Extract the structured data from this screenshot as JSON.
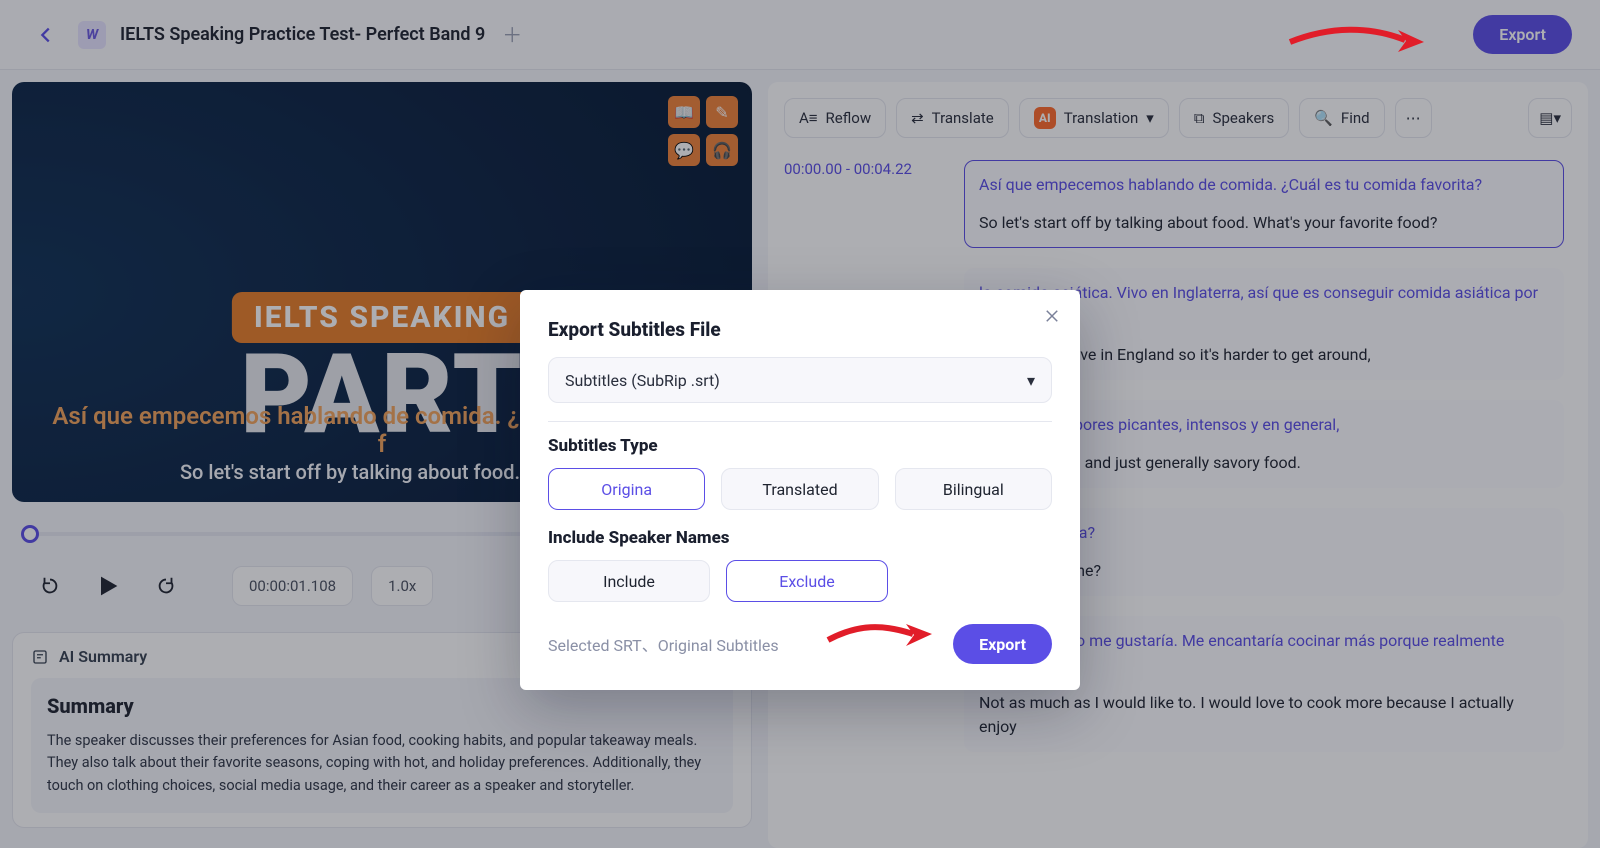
{
  "header": {
    "title": "IELTS Speaking Practice Test- Perfect Band 9",
    "export_label": "Export"
  },
  "video": {
    "ielts_pill": "IELTS SPEAKING",
    "part": "PART",
    "caption_translated": "Así que empecemos hablando de comida. ¿Cuál es tu comida f",
    "caption_original": "So let's start off by talking about food. What's"
  },
  "player": {
    "timecode": "00:00:01.108",
    "speed": "1.0x"
  },
  "summary": {
    "chip": "AI Summary",
    "heading": "Summary",
    "body": "The speaker discusses their preferences for Asian food, cooking habits, and popular takeaway meals. They also talk about their favorite seasons, coping with hot, and holiday preferences. Additionally, they touch on clothing choices, social media usage, and their career as a speaker and storyteller."
  },
  "right_toolbar": {
    "reflow": "Reflow",
    "translate": "Translate",
    "translation": "Translation",
    "speakers": "Speakers",
    "find": "Find"
  },
  "transcript": [
    {
      "ts": "00:00.00 - 00:04.22",
      "es": "Así que empecemos hablando de comida. ¿Cuál es tu comida favorita?",
      "en": "So let's start off by talking about food. What's your favorite food?",
      "selected": true
    },
    {
      "ts": "",
      "es": "la comida asiática. Vivo en Inglaterra, así que es conseguir comida asiática por aquí,",
      "en": "Asian food. I live in England so it's harder to get around,"
    },
    {
      "ts": "",
      "es": "gustan los sabores picantes, intensos y en general,",
      "en": "spicy, flavorful and just generally savory food."
    },
    {
      "ts": "",
      "es": "mucho en casa?",
      "en": "ok a lot at home?"
    },
    {
      "ts": "",
      "es": "No tanto como me gustaría. Me encantaría cocinar más porque realmente disfruto",
      "en": "Not as much as I would like to. I would love to cook more because I actually enjoy"
    }
  ],
  "modal": {
    "title": "Export Subtitles File",
    "format": "Subtitles (SubRip .srt)",
    "type_label": "Subtitles Type",
    "types": {
      "original": "Origina",
      "translated": "Translated",
      "bilingual": "Bilingual"
    },
    "speaker_label": "Include Speaker Names",
    "speaker": {
      "include": "Include",
      "exclude": "Exclude"
    },
    "meta": "Selected SRT、Original Subtitles",
    "go": "Export"
  }
}
